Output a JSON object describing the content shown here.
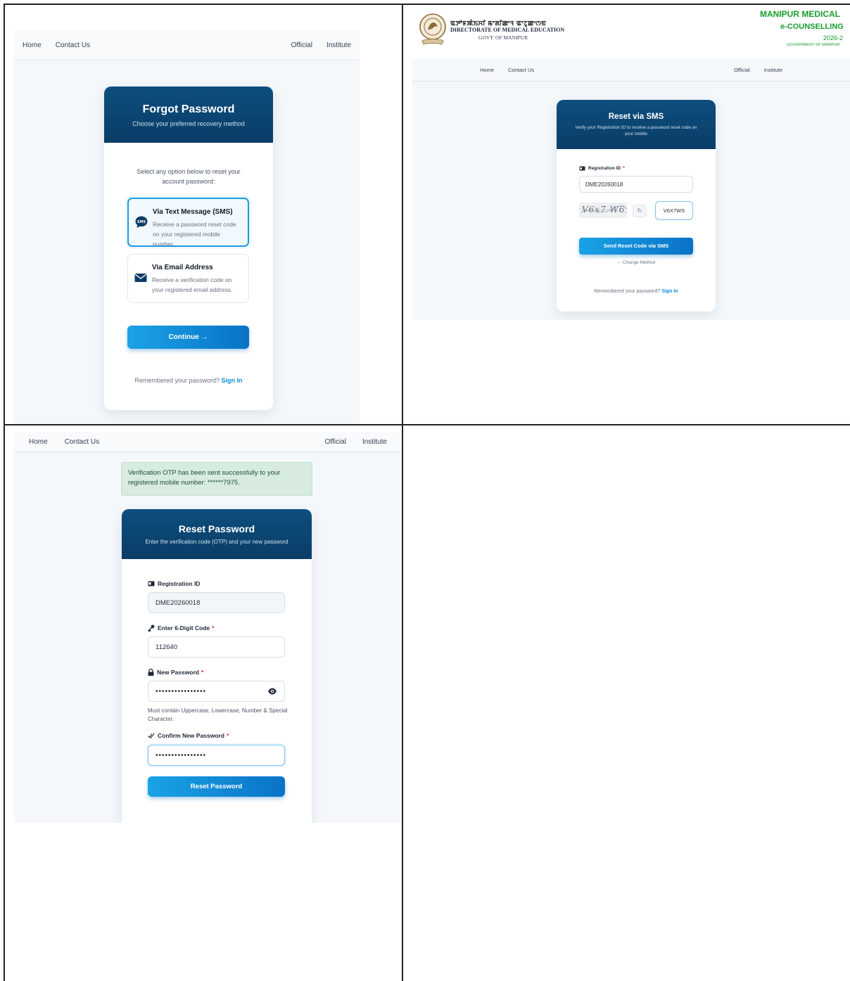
{
  "panel1": {
    "nav": {
      "home": "Home",
      "contact": "Contact Us",
      "official": "Official",
      "institute": "Institute"
    },
    "card": {
      "title": "Forgot Password",
      "subtitle": "Choose your preferred recovery method",
      "intro": "Select any option below to reset your account password:",
      "options": [
        {
          "title": "Via Text Message (SMS)",
          "desc": "Receive a password reset code on your registered mobile number.",
          "icon": "sms-icon",
          "selected": true
        },
        {
          "title": "Via Email Address",
          "desc": "Receive a verification code on your registered email address.",
          "icon": "envelope-icon",
          "selected": false
        }
      ],
      "continue_label": "Continue →",
      "footer_text": "Remembered your password?",
      "signin_label": "Sign In"
    }
  },
  "panel2": {
    "header": {
      "native_script": "ꯑꯇꯣꯝꯄꯥꯏꯆꯤ ꯃꯦꯗꯤꯀꯦꯜ ꯑꯦꯖꯨꯀꯦꯁꯟ",
      "department": "DIRECTORATE OF MEDICAL EDUCATION",
      "govt": "GOVT. OF MANIPUR",
      "brand_line1": "MANIPUR MEDICAL",
      "brand_line2": "e-COUNSELLING",
      "brand_line3": "2026-2",
      "brand_line4": "GOVERNMENT OF MANIPUR"
    },
    "nav": {
      "home": "Home",
      "contact": "Contact Us",
      "official": "Official",
      "institute": "Institute"
    },
    "card": {
      "title": "Reset via SMS",
      "subtitle": "Verify your Registration ID to receive a password reset code on your mobile",
      "reg_label": "Registration ID",
      "required_mark": "*",
      "reg_value": "DME20260018",
      "captcha_text": "V6x7 W6",
      "captcha_input": "V6X7WS",
      "send_label": "Send Reset Code via SMS",
      "change_method": "← Change Method",
      "footer_text": "Remembered your password?",
      "signin_label": "Sign In"
    }
  },
  "panel3": {
    "nav": {
      "home": "Home",
      "contact": "Contact Us",
      "official": "Official",
      "institute": "Institute"
    },
    "alert": "Verification OTP has been sent successfully to your registered mobile number: ******7975.",
    "card": {
      "title": "Reset Password",
      "subtitle": "Enter the verification code (OTP) and your new password",
      "reg_label": "Registration ID",
      "reg_value": "DME20260018",
      "code_label": "Enter 6-Digit Code",
      "code_value": "112640",
      "newpw_label": "New Password",
      "newpw_value": "••••••••••••••••",
      "hint": "Must contain Uppercase, Lowercase, Number & Special Character.",
      "confirm_label": "Confirm New Password",
      "confirm_value": "••••••••••••••••",
      "required_mark": "*",
      "reset_label": "Reset Password"
    }
  },
  "colors": {
    "header_navy": "#0a3d66",
    "accent_blue": "#1aa3e6",
    "brand_green": "#199c2d",
    "alert_bg": "#d7ebdf"
  }
}
